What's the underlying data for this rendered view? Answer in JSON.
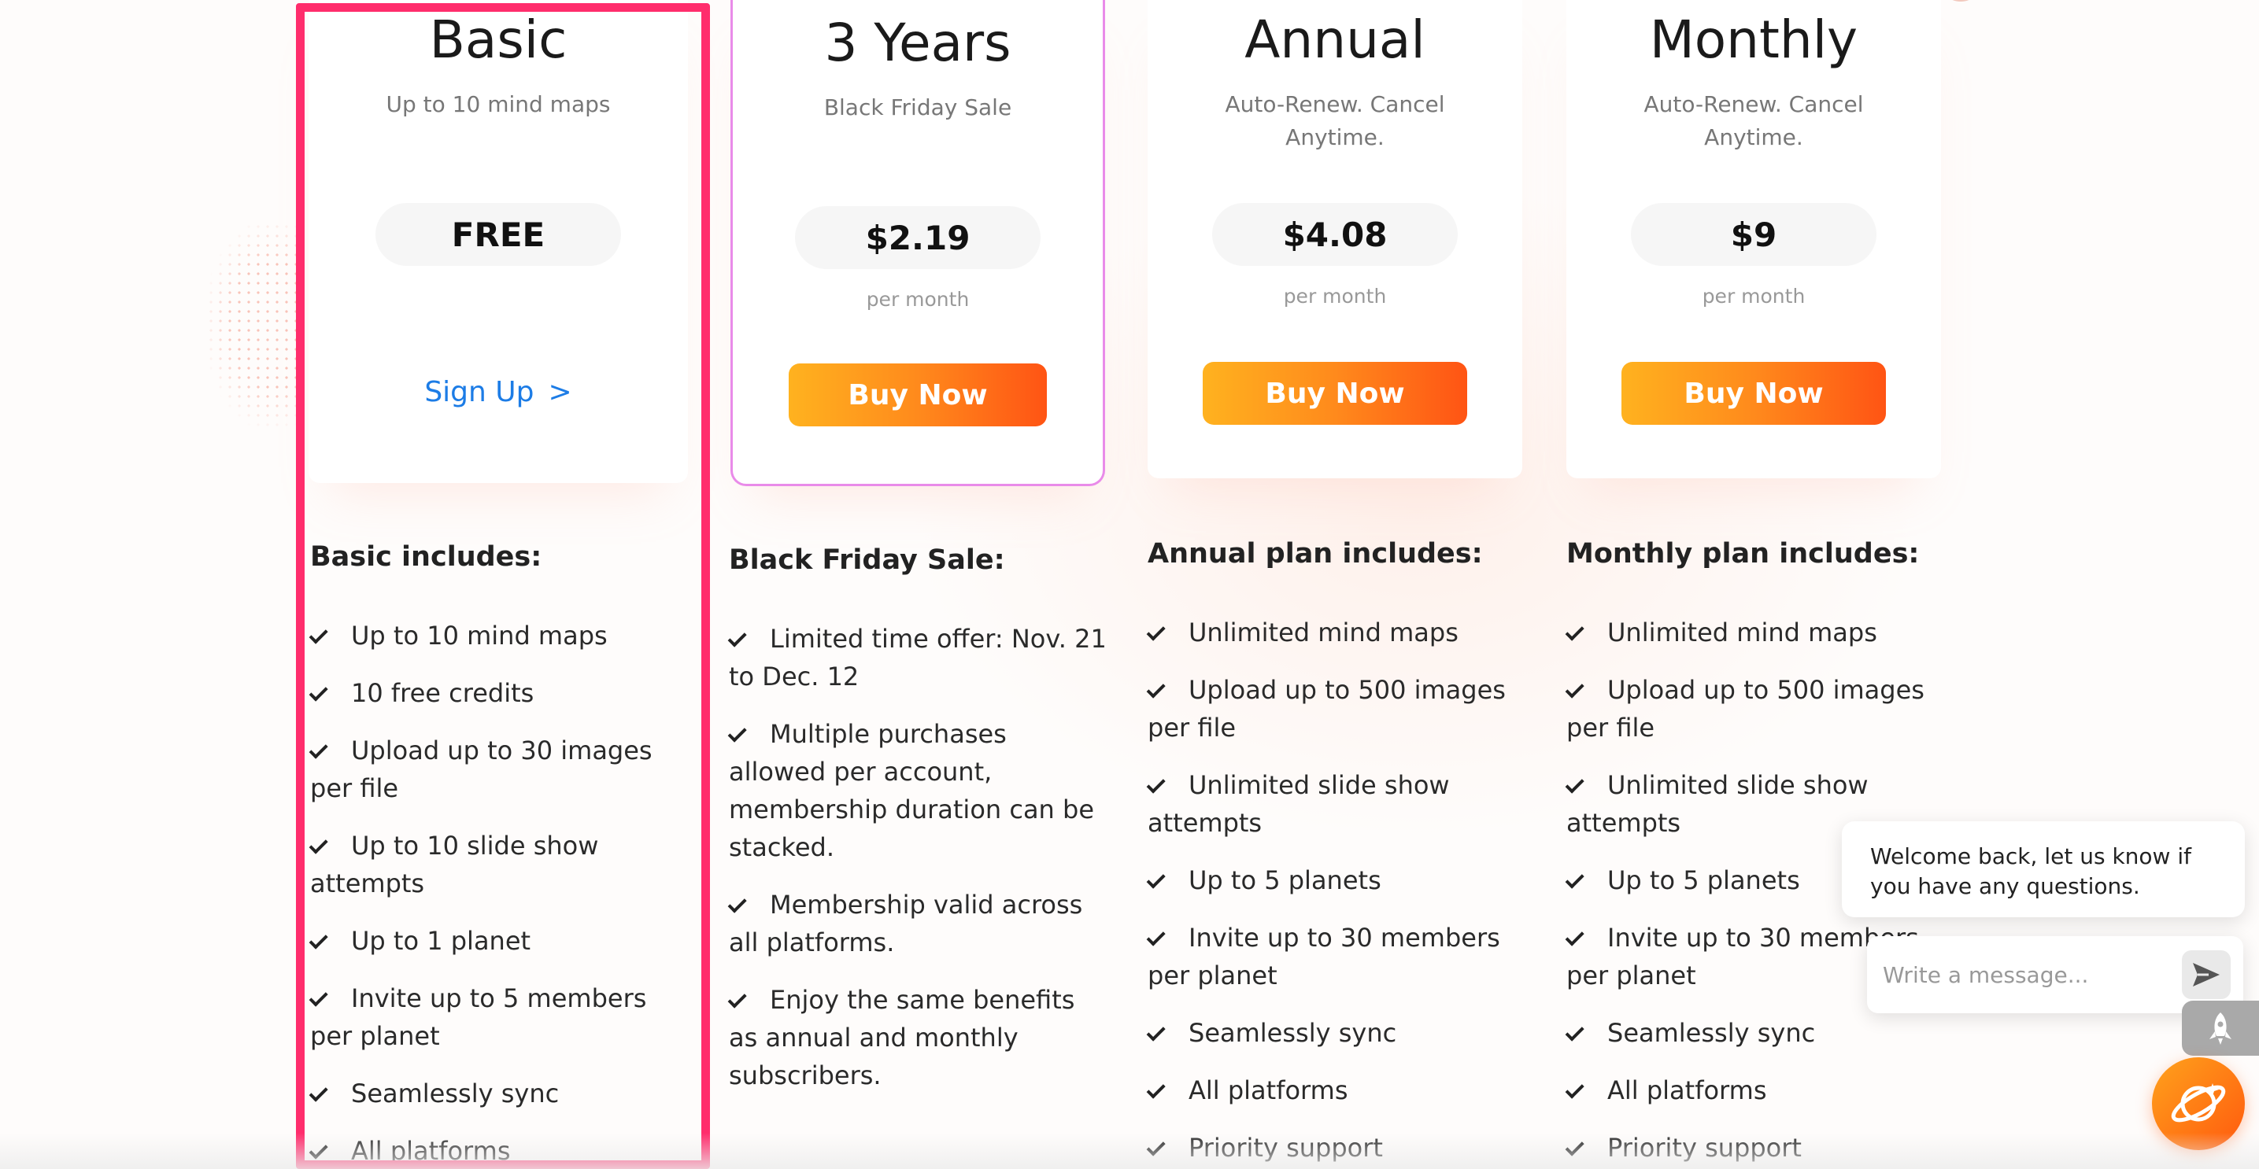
{
  "plans": [
    {
      "title": "Basic",
      "subtitle": "Up to 10 mind maps",
      "price": "FREE",
      "cta": "Sign Up",
      "cta_chevron": ">",
      "includes_title": "Basic includes:",
      "features": [
        "Up to 10 mind maps",
        "10 free credits",
        "Upload up to 30 images per file",
        "Up to 10 slide show attempts",
        "Up to 1 planet",
        "Invite up to 5 members per planet",
        "Seamlessly sync",
        "All platforms"
      ]
    },
    {
      "title": "3 Years",
      "subtitle": "Black Friday Sale",
      "price": "$2.19",
      "period": "per month",
      "cta": "Buy Now",
      "includes_title": "Black Friday Sale:",
      "features": [
        "Limited time offer: Nov. 21 to Dec. 12",
        "Multiple purchases allowed per account, membership duration can be stacked.",
        "Membership valid across all platforms.",
        "Enjoy the same benefits as annual and monthly subscribers."
      ]
    },
    {
      "title": "Annual",
      "subtitle": "Auto-Renew. Cancel Anytime.",
      "price": "$4.08",
      "period": "per month",
      "cta": "Buy Now",
      "includes_title": "Annual plan includes:",
      "features": [
        "Unlimited mind maps",
        "Upload up to 500 images per file",
        "Unlimited slide show attempts",
        "Up to 5 planets",
        "Invite up to 30 members per planet",
        "Seamlessly sync",
        "All platforms",
        "Priority support"
      ]
    },
    {
      "title": "Monthly",
      "subtitle": "Auto-Renew. Cancel Anytime.",
      "price": "$9",
      "period": "per month",
      "cta": "Buy Now",
      "includes_title": "Monthly plan includes:",
      "features": [
        "Unlimited mind maps",
        "Upload up to 500 images per file",
        "Unlimited slide show attempts",
        "Up to 5 planets",
        "Invite up to 30 members per planet",
        "Seamlessly sync",
        "All platforms",
        "Priority support"
      ]
    }
  ],
  "chat": {
    "welcome": "Welcome back, let us know if you have any questions.",
    "placeholder": "Write a message..."
  },
  "icons": {
    "check": "check-icon",
    "send": "send-icon",
    "rocket": "rocket-icon",
    "launcher": "planet-icon"
  },
  "colors": {
    "accent_start": "#ffb21f",
    "accent_end": "#ff5414",
    "link": "#1c7ce6",
    "selection": "#ff2d6c",
    "highlight_border": "#e98be9"
  }
}
